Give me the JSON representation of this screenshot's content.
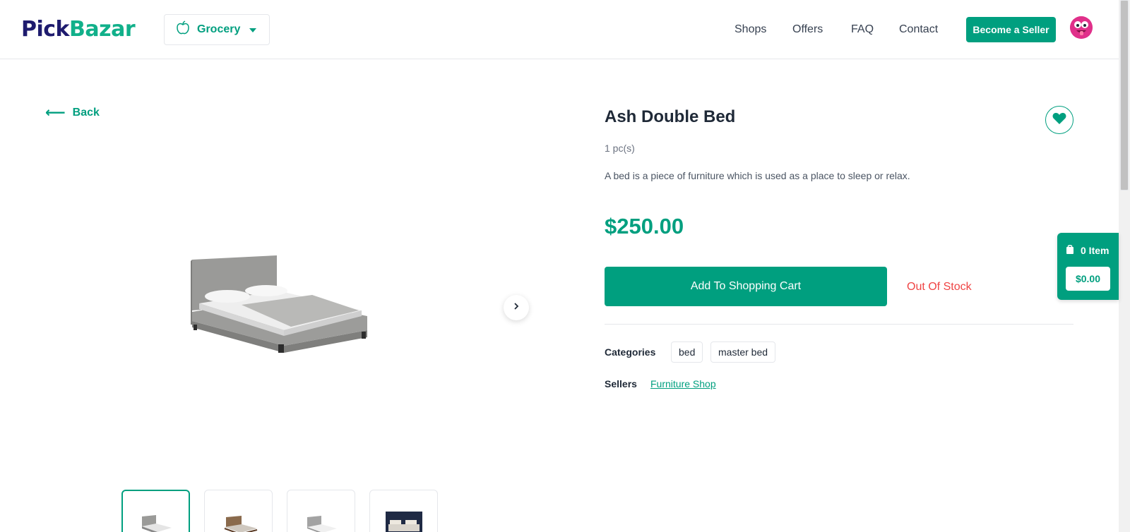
{
  "header": {
    "logo_part1": "Pick",
    "logo_part2": "Bazar",
    "shop_type": "Grocery",
    "nav": [
      "Shops",
      "Offers",
      "FAQ",
      "Contact"
    ],
    "become_seller": "Become a Seller"
  },
  "back_label": "Back",
  "product": {
    "name": "Ash Double Bed",
    "unit": "1 pc(s)",
    "description": "A bed is a piece of furniture which is used as a place to sleep or relax.",
    "price": "$250.00",
    "add_to_cart": "Add To Shopping Cart",
    "stock_status": "Out Of Stock",
    "categories_label": "Categories",
    "categories": [
      "bed",
      "master bed"
    ],
    "sellers_label": "Sellers",
    "seller": "Furniture Shop"
  },
  "cart": {
    "items": "0 Item",
    "total": "$0.00"
  },
  "colors": {
    "accent": "#009f7f",
    "logo_dark": "#1e1b6e",
    "out_of_stock": "#ef4444"
  }
}
